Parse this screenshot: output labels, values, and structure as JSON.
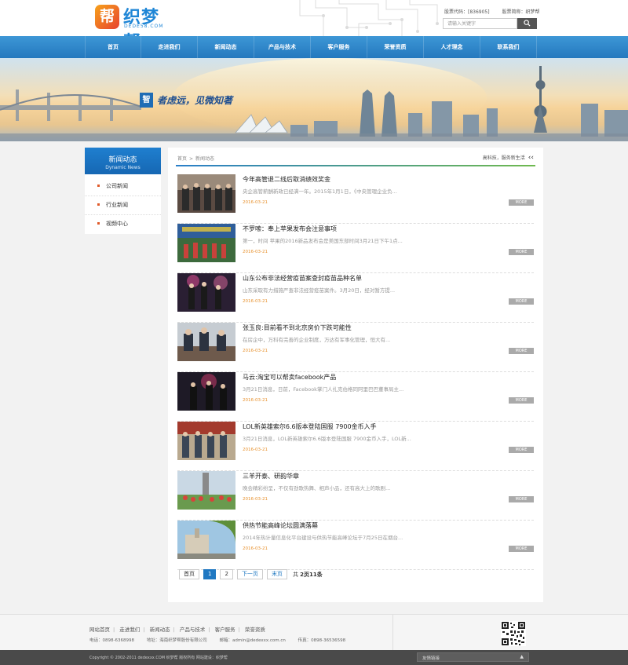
{
  "brand": {
    "logo_char": "帮",
    "name": "织梦帮",
    "domain": "DEDE58.COM"
  },
  "header": {
    "stock_code": "股票代码：[836905]",
    "stock_name": "股票简称：织梦帮",
    "search_placeholder": "请输入关键字",
    "search_icon": "search-icon"
  },
  "nav": {
    "items": [
      "首页",
      "走进我们",
      "新闻动态",
      "产品与技术",
      "客户服务",
      "荣誉资质",
      "人才理念",
      "联系我们"
    ]
  },
  "banner": {
    "badge": "智",
    "slogan": "者虑远，见微知著"
  },
  "sidebar": {
    "title": "新闻动态",
    "subtitle": "Dynamic News",
    "items": [
      "公司新闻",
      "行业新闻",
      "视频中心"
    ]
  },
  "breadcrumb": {
    "home": "首页",
    "sep": ">",
    "current": "新闻动态",
    "right_text": "高科技，服务新生活",
    "arrows": "‹‹"
  },
  "news": [
    {
      "title": "今年高管退二线后取消绩效奖金",
      "desc": "央企高管薪酬新政已经满一年。2015年1月1日，《中央管理企业负...",
      "date": "2016-03-21",
      "more": "MORE"
    },
    {
      "title": "不罗嗦：奉上苹果发布会注意事项",
      "desc": "第一，时间 苹果的2016新品发布会是美国东部时间3月21日下午1点...",
      "date": "2016-03-21",
      "more": "MORE"
    },
    {
      "title": "山东公布非法经营疫苗案查封疫苗品种名单",
      "desc": "山东采取有力措施严查非法经营疫苗案件。3月20日，经对暂方提...",
      "date": "2016-03-21",
      "more": "MORE"
    },
    {
      "title": "张玉良:目前看不到北京房价下跌可能性",
      "desc": "在房企中，万科有完善的企业制度，万达有军事化管理，恒大有...",
      "date": "2016-03-21",
      "more": "MORE"
    },
    {
      "title": "马云:淘宝可以帮卖facebook产品",
      "desc": "3月21日消息，日前，Facebook掌门人扎克伯格同阿里巴巴董事局主...",
      "date": "2016-03-21",
      "more": "MORE"
    },
    {
      "title": "LOL新英雄索尔6.6版本登陆国服 7900金币入手",
      "desc": "3月21日消息，LOL新英雄索尔6.6版本登陆国服 7900金币入手，LOL新...",
      "date": "2016-03-21",
      "more": "MORE"
    },
    {
      "title": "三羊开泰、研韵华章",
      "desc": "晚会精彩纷呈，不仅有劲歌热舞、相声小品，还有高大上的歌剧...",
      "date": "2016-03-21",
      "more": "MORE"
    },
    {
      "title": "供热节能高峰论坛圆满落幕",
      "desc": "2014年热计量信息化平台建设与供热节能高峰论坛于7月25日在烟台...",
      "date": "2016-03-21",
      "more": "MORE"
    }
  ],
  "pager": {
    "first": "首页",
    "pages": [
      "1",
      "2"
    ],
    "next": "下一页",
    "last": "末页",
    "total_prefix": "共",
    "total_pages": "2页",
    "total_count": "11条"
  },
  "footer": {
    "links": [
      "网站首页",
      "走进我们",
      "新闻动态",
      "产品与技术",
      "客户服务",
      "荣誉资质"
    ],
    "phone": "电话：0898-6368998",
    "address": "地址：海南织梦帮股份有限公司",
    "email": "邮箱：admin@dedexxx.com.cn",
    "fax": "传真：0898-36536598",
    "qr_icon": "qr-code-icon",
    "copyright": "Copyright © 2002-2011 dedexxx.COM 织梦帮 版权所有 网站建设：织梦帮",
    "friend_label": "友情链接",
    "friend_arrow": "▲"
  },
  "colors": {
    "nav_blue": "#2a86cb",
    "accent_orange": "#e7912e",
    "pager_active": "#1f78c2"
  }
}
